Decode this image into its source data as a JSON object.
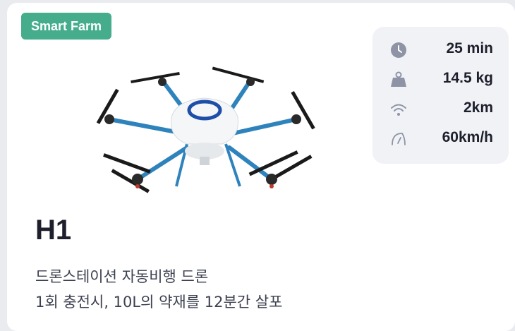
{
  "badge": "Smart Farm",
  "specs": [
    {
      "icon": "clock-icon",
      "value": "25 min"
    },
    {
      "icon": "weight-icon",
      "value": "14.5 kg"
    },
    {
      "icon": "wifi-icon",
      "value": "2km"
    },
    {
      "icon": "speedometer-icon",
      "value": "60km/h"
    }
  ],
  "product": {
    "name": "H1",
    "desc_line1": "드론스테이션  자동비행 드론",
    "desc_line2": "1회 충전시, 10L의 약재를 12분간 살포"
  },
  "colors": {
    "badge": "#45ad8c",
    "icon": "#8e94a6",
    "text": "#1d1f2c",
    "panel": "#f1f2f6"
  }
}
